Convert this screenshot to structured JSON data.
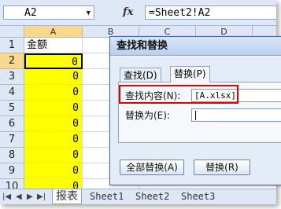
{
  "formula_bar": {
    "name_box": "A2",
    "fx_label": "fx",
    "formula": "=Sheet2!A2"
  },
  "grid": {
    "columns": [
      "A",
      "B",
      "C",
      "D"
    ],
    "row_numbers": [
      "1",
      "2",
      "3",
      "4",
      "5",
      "6",
      "7",
      "8",
      "9",
      "10"
    ],
    "a1_header": "金额",
    "values": [
      "0",
      "0",
      "0",
      "0",
      "0",
      "0",
      "0",
      "0",
      "0"
    ]
  },
  "sheet_tabs": {
    "active": "报表",
    "others": [
      "Sheet1",
      "Sheet2",
      "Sheet3"
    ]
  },
  "dialog": {
    "title": "查找和替换",
    "tab_find": "查找(D)",
    "tab_replace": "替换(P)",
    "find_label": "查找内容(N):",
    "find_value": "[A.xlsx]",
    "replace_label": "替换为(E):",
    "replace_value": "",
    "replace_all_button": "全部替换(A)",
    "replace_button": "替换(R)"
  },
  "colors": {
    "highlight_fill": "#ffff00",
    "annotation_red": "#e00000"
  }
}
